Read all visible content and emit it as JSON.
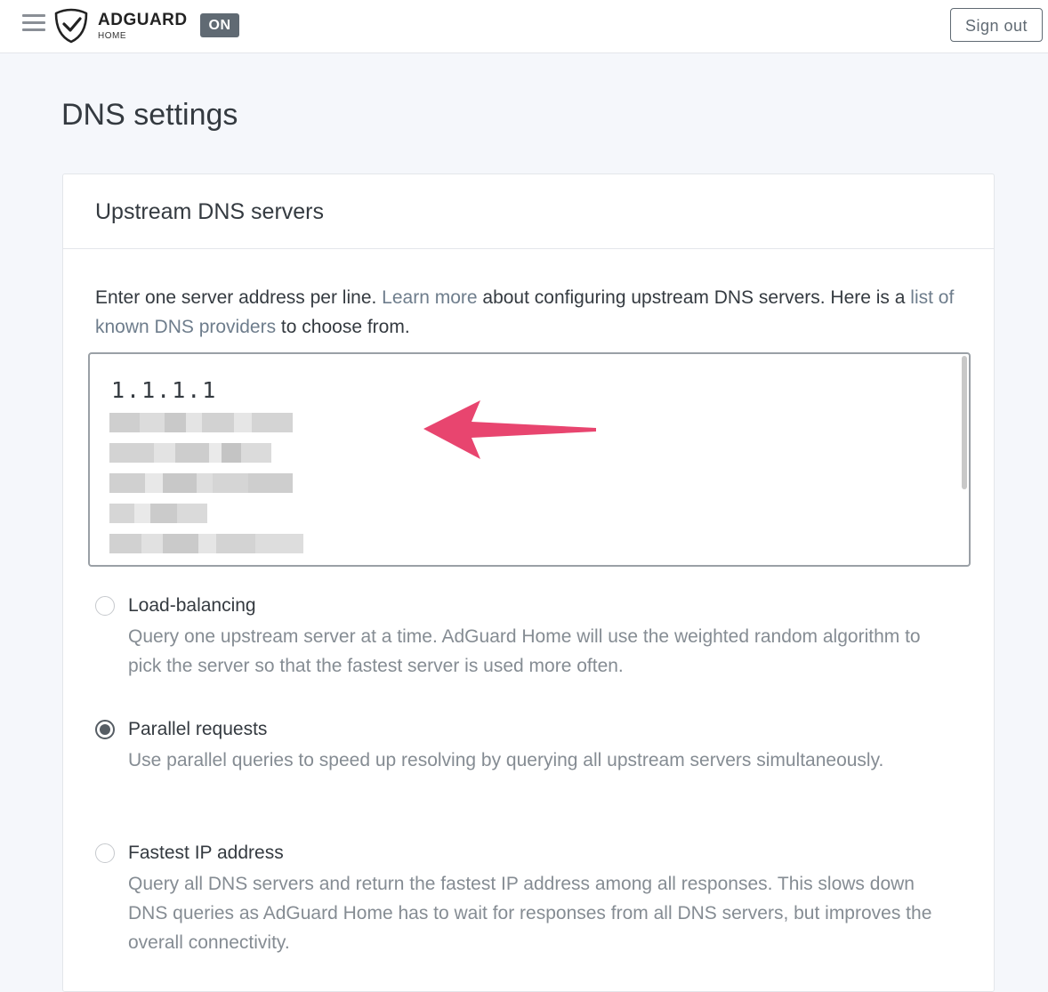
{
  "header": {
    "brand_name": "ADGUARD",
    "brand_sub": "HOME",
    "status_badge": "ON",
    "signout_label": "Sign out"
  },
  "page": {
    "title": "DNS settings"
  },
  "upstream": {
    "card_title": "Upstream DNS servers",
    "desc_part1": "Enter one server address per line. ",
    "learn_more": "Learn more",
    "desc_part2": " about configuring upstream DNS servers. Here is a ",
    "providers_link": "list of known DNS providers",
    "desc_part3": " to choose from.",
    "textarea_first_line": "1.1.1.1"
  },
  "options": [
    {
      "title": "Load-balancing",
      "desc": "Query one upstream server at a time. AdGuard Home will use the weighted random algorithm to pick the server so that the fastest server is used more often.",
      "checked": false
    },
    {
      "title": "Parallel requests",
      "desc": "Use parallel queries to speed up resolving by querying all upstream servers simultaneously.",
      "checked": true
    },
    {
      "title": "Fastest IP address",
      "desc": "Query all DNS servers and return the fastest IP address among all responses. This slows down DNS queries as AdGuard Home has to wait for responses from all DNS servers, but improves the overall connectivity.",
      "checked": false
    }
  ],
  "colors": {
    "accent_arrow": "#e8456f",
    "badge_bg": "#606a73",
    "link": "#6e7d8c"
  }
}
